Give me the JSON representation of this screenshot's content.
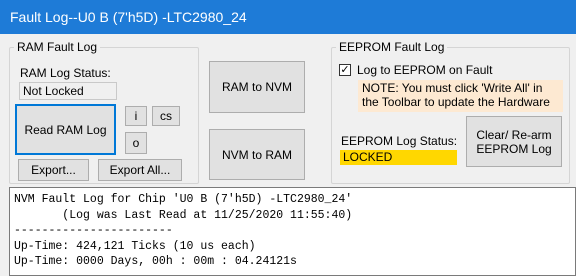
{
  "window": {
    "title": "Fault Log--U0 B (7'h5D) -LTC2980_24"
  },
  "ram_group": {
    "legend": "RAM Fault Log",
    "status_label": "RAM Log Status:",
    "status_value": "Not Locked",
    "read_button": "Read RAM Log",
    "i_button": "i",
    "cs_button": "cs",
    "o_button": "o",
    "export_button": "Export...",
    "export_all_button": "Export All..."
  },
  "middle": {
    "ram_to_nvm_button": "RAM to NVM",
    "nvm_to_ram_button": "NVM to RAM"
  },
  "eeprom_group": {
    "legend": "EEPROM Fault Log",
    "log_checkbox_label": "Log to EEPROM on Fault",
    "log_checkbox_checked": true,
    "note_line1": "NOTE: You must click 'Write All' in",
    "note_line2": "the Toolbar to update the Hardware",
    "status_label": "EEPROM Log Status:",
    "status_value": "LOCKED",
    "clear_button_line1": "Clear/ Re-arm",
    "clear_button_line2": "EEPROM Log"
  },
  "console": {
    "lines": [
      "NVM Fault Log for Chip 'U0 B (7'h5D) -LTC2980_24'",
      "       (Log was Last Read at 11/25/2020 11:55:40)",
      "-----------------------",
      "Up-Time: 424,121 Ticks (10 us each)",
      "Up-Time: 0000 Days, 00h : 00m : 04.24121s"
    ]
  }
}
